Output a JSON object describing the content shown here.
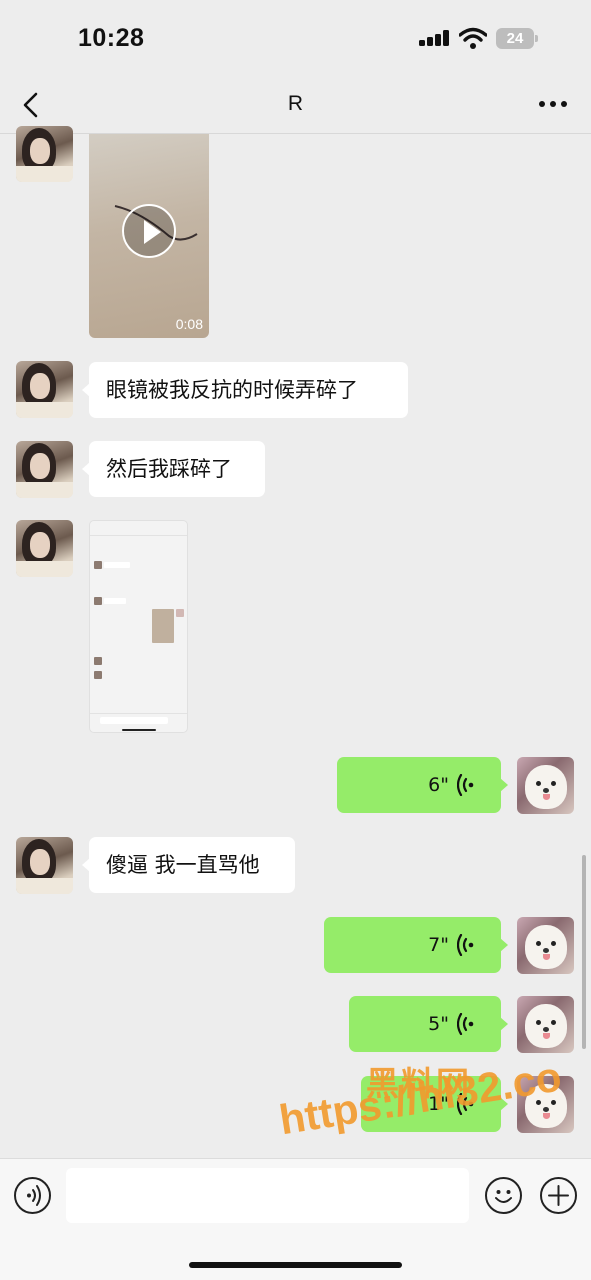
{
  "status_bar": {
    "time": "10:28",
    "battery": "24",
    "icons": [
      "signal-icon",
      "wifi-icon",
      "battery-icon"
    ]
  },
  "nav": {
    "title": "R",
    "back_icon": "chevron-left-icon",
    "more_icon": "more-dots-icon"
  },
  "messages": [
    {
      "from": "contact",
      "kind": "video",
      "duration": "0:08"
    },
    {
      "from": "contact",
      "kind": "text",
      "text": "眼镜被我反抗的时候弄碎了"
    },
    {
      "from": "contact",
      "kind": "text",
      "text": "然后我踩碎了"
    },
    {
      "from": "contact",
      "kind": "image",
      "content": "chat screenshot"
    },
    {
      "from": "me",
      "kind": "voice",
      "duration": "6\""
    },
    {
      "from": "contact",
      "kind": "text",
      "text": "傻逼 我一直骂他"
    },
    {
      "from": "me",
      "kind": "voice",
      "duration": "7\""
    },
    {
      "from": "me",
      "kind": "voice",
      "duration": "5\""
    },
    {
      "from": "me",
      "kind": "voice",
      "duration": "1\""
    }
  ],
  "watermark": {
    "line1": "黑料网",
    "line2": "https://hl32.co"
  },
  "input_bar": {
    "value": "",
    "icons": [
      "voice-toggle-icon",
      "emoji-icon",
      "plus-icon"
    ]
  },
  "colors": {
    "background": "#ededed",
    "voice_bubble": "#95ec69",
    "text_bubble": "#ffffff",
    "watermark": "#f29a2e"
  }
}
